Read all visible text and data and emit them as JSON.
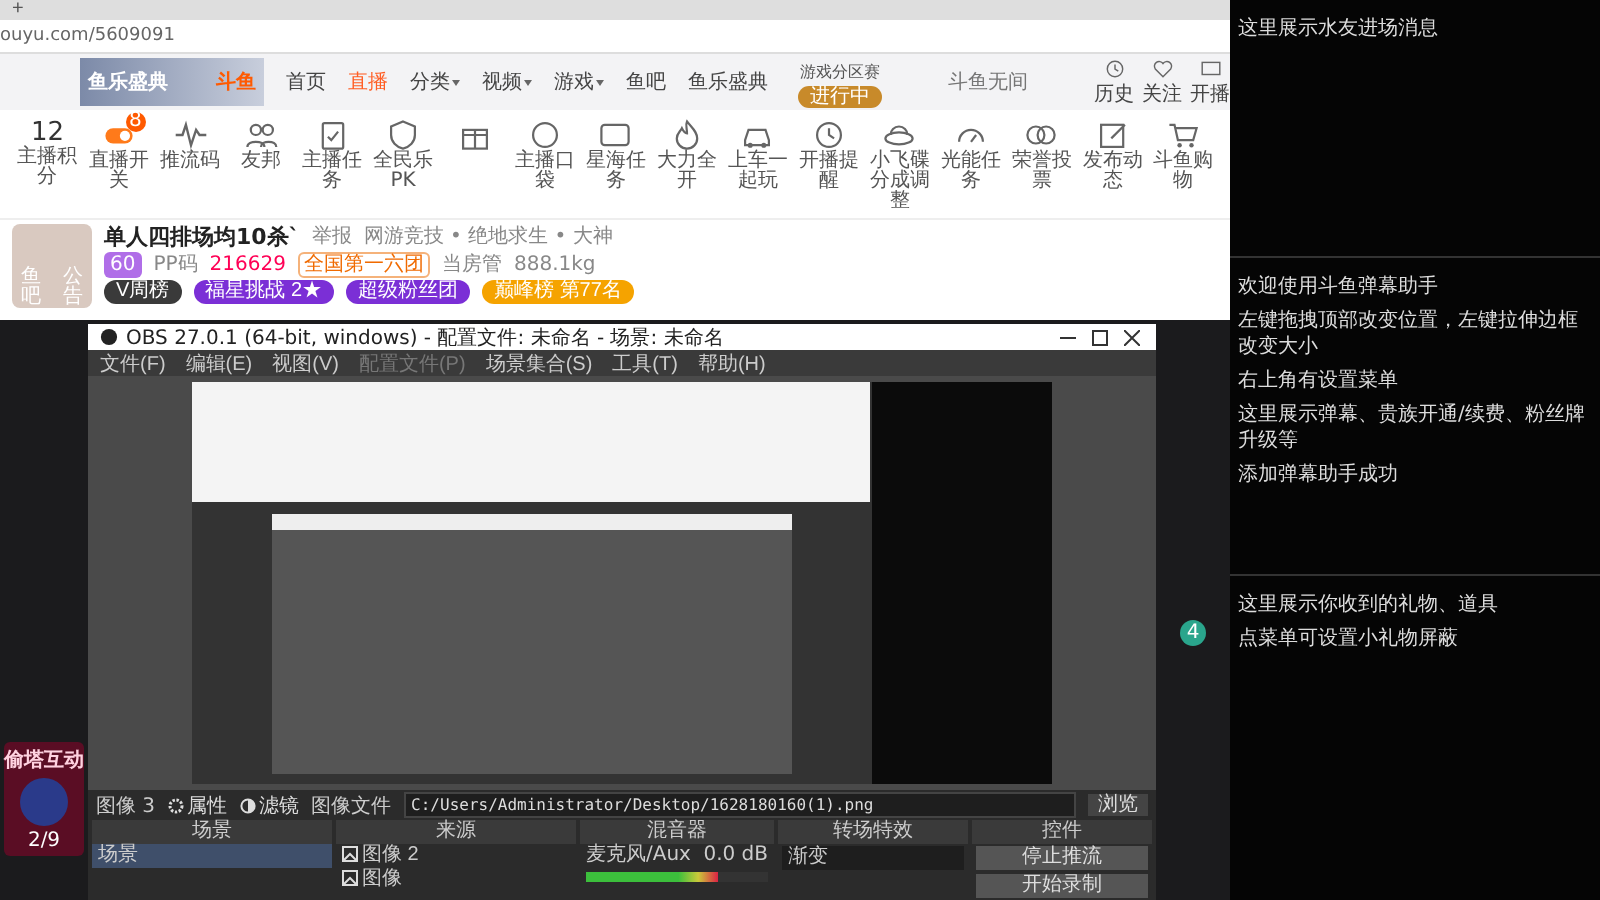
{
  "browser": {
    "new_tab": "+",
    "url": "ouyu.com/5609091"
  },
  "nav": {
    "logo_text": "鱼乐盛典",
    "brand": "斗鱼",
    "items": [
      {
        "label": "首页",
        "selected": false,
        "caret": false
      },
      {
        "label": "直播",
        "selected": true,
        "caret": false
      },
      {
        "label": "分类",
        "selected": false,
        "caret": true
      },
      {
        "label": "视频",
        "selected": false,
        "caret": true
      },
      {
        "label": "游戏",
        "selected": false,
        "caret": true
      },
      {
        "label": "鱼吧",
        "selected": false,
        "caret": false
      },
      {
        "label": "鱼乐盛典",
        "selected": false,
        "caret": false
      }
    ],
    "event": {
      "title": "游戏分区赛",
      "badge": "进行中"
    },
    "search_placeholder": "斗鱼无间",
    "actions": [
      {
        "label": "历史",
        "kind": "clock"
      },
      {
        "label": "关注",
        "kind": "heart"
      },
      {
        "label": "开播",
        "kind": "screen"
      }
    ]
  },
  "toolbar": {
    "score": "12",
    "score_label": "主播积分",
    "items": [
      {
        "label": "直播开关",
        "kind": "toggle",
        "badge": "8"
      },
      {
        "label": "推流码",
        "kind": "wave"
      },
      {
        "label": "友邦",
        "kind": "people"
      },
      {
        "label": "主播任务",
        "kind": "clipboard"
      },
      {
        "label": "全民乐PK",
        "kind": "shield"
      },
      {
        "kind": "gift"
      },
      {
        "label": "主播口袋",
        "kind": "circle"
      },
      {
        "label": "星海任务",
        "kind": "ad"
      },
      {
        "label": "大力全开",
        "kind": "flame"
      },
      {
        "label": "上车一起玩",
        "kind": "car"
      },
      {
        "label": "开播提醒",
        "kind": "clock"
      },
      {
        "label": "小飞碟分成调整",
        "kind": "ufo"
      },
      {
        "label": "光能任务",
        "kind": "gauge"
      },
      {
        "label": "荣誉投票",
        "kind": "coins"
      },
      {
        "label": "发布动态",
        "kind": "pen"
      },
      {
        "label": "斗鱼购物",
        "kind": "cart"
      }
    ]
  },
  "streamer": {
    "avatar_links": [
      "鱼吧",
      "公告"
    ],
    "title": "单人四排场均10杀`",
    "report": "举报",
    "category": "网游竞技 • 绝地求生 • 大神",
    "level": "60",
    "level_name": "PP码",
    "hot": "216629",
    "rank_tag": "全国第一六团",
    "room_admin": "当房管",
    "weight": "888.1kg",
    "badges": [
      {
        "label": "V周榜",
        "color": "#3a3a3a"
      },
      {
        "label": "福星挑战 2★",
        "color": "#7b2fd6"
      },
      {
        "label": "超级粉丝团",
        "color": "#7b2fd6"
      },
      {
        "label": "巅峰榜 第77名",
        "color": "#f5a300"
      }
    ]
  },
  "side_widget": {
    "title": "偷塔互动",
    "count": "2/9"
  },
  "studio_strip": {
    "badge": "4"
  },
  "obs": {
    "title": "OBS 27.0.1 (64-bit, windows) - 配置文件: 未命名 - 场景: 未命名",
    "menu": [
      {
        "label": "文件(F)",
        "disabled": false
      },
      {
        "label": "编辑(E)",
        "disabled": false
      },
      {
        "label": "视图(V)",
        "disabled": false
      },
      {
        "label": "配置文件(P)",
        "disabled": true
      },
      {
        "label": "场景集合(S)",
        "disabled": false
      },
      {
        "label": "工具(T)",
        "disabled": false
      },
      {
        "label": "帮助(H)",
        "disabled": false
      }
    ],
    "source_name": "图像 3",
    "properties": "属性",
    "filters": "滤镜",
    "file_label": "图像文件",
    "file_path": "C:/Users/Administrator/Desktop/1628180160(1).png",
    "browse": "浏览",
    "docks": {
      "scenes": {
        "title": "场景",
        "items": [
          {
            "label": "场景",
            "selected": true
          }
        ]
      },
      "sources": {
        "title": "来源",
        "items": [
          {
            "label": "图像 2"
          },
          {
            "label": "图像"
          }
        ]
      },
      "mixer": {
        "title": "混音器",
        "channel": "麦克风/Aux",
        "reading": "0.0 dB",
        "level": 0.72
      },
      "transitions": {
        "title": "转场特效",
        "value": "渐变"
      },
      "controls": {
        "title": "控件",
        "buttons": [
          "停止推流",
          "开始录制"
        ]
      }
    }
  },
  "assistant": {
    "sections": [
      {
        "lines": [
          "这里展示水友进场消息"
        ]
      },
      {
        "lines": [
          "欢迎使用斗鱼弹幕助手",
          "左键拖拽顶部改变位置，左键拉伸边框改变大小",
          "右上角有设置菜单",
          "这里展示弹幕、贵族开通/续费、粉丝牌升级等",
          "添加弹幕助手成功"
        ]
      },
      {
        "lines": [
          "这里展示你收到的礼物、道具",
          "点菜单可设置小礼物屏蔽"
        ]
      }
    ]
  }
}
